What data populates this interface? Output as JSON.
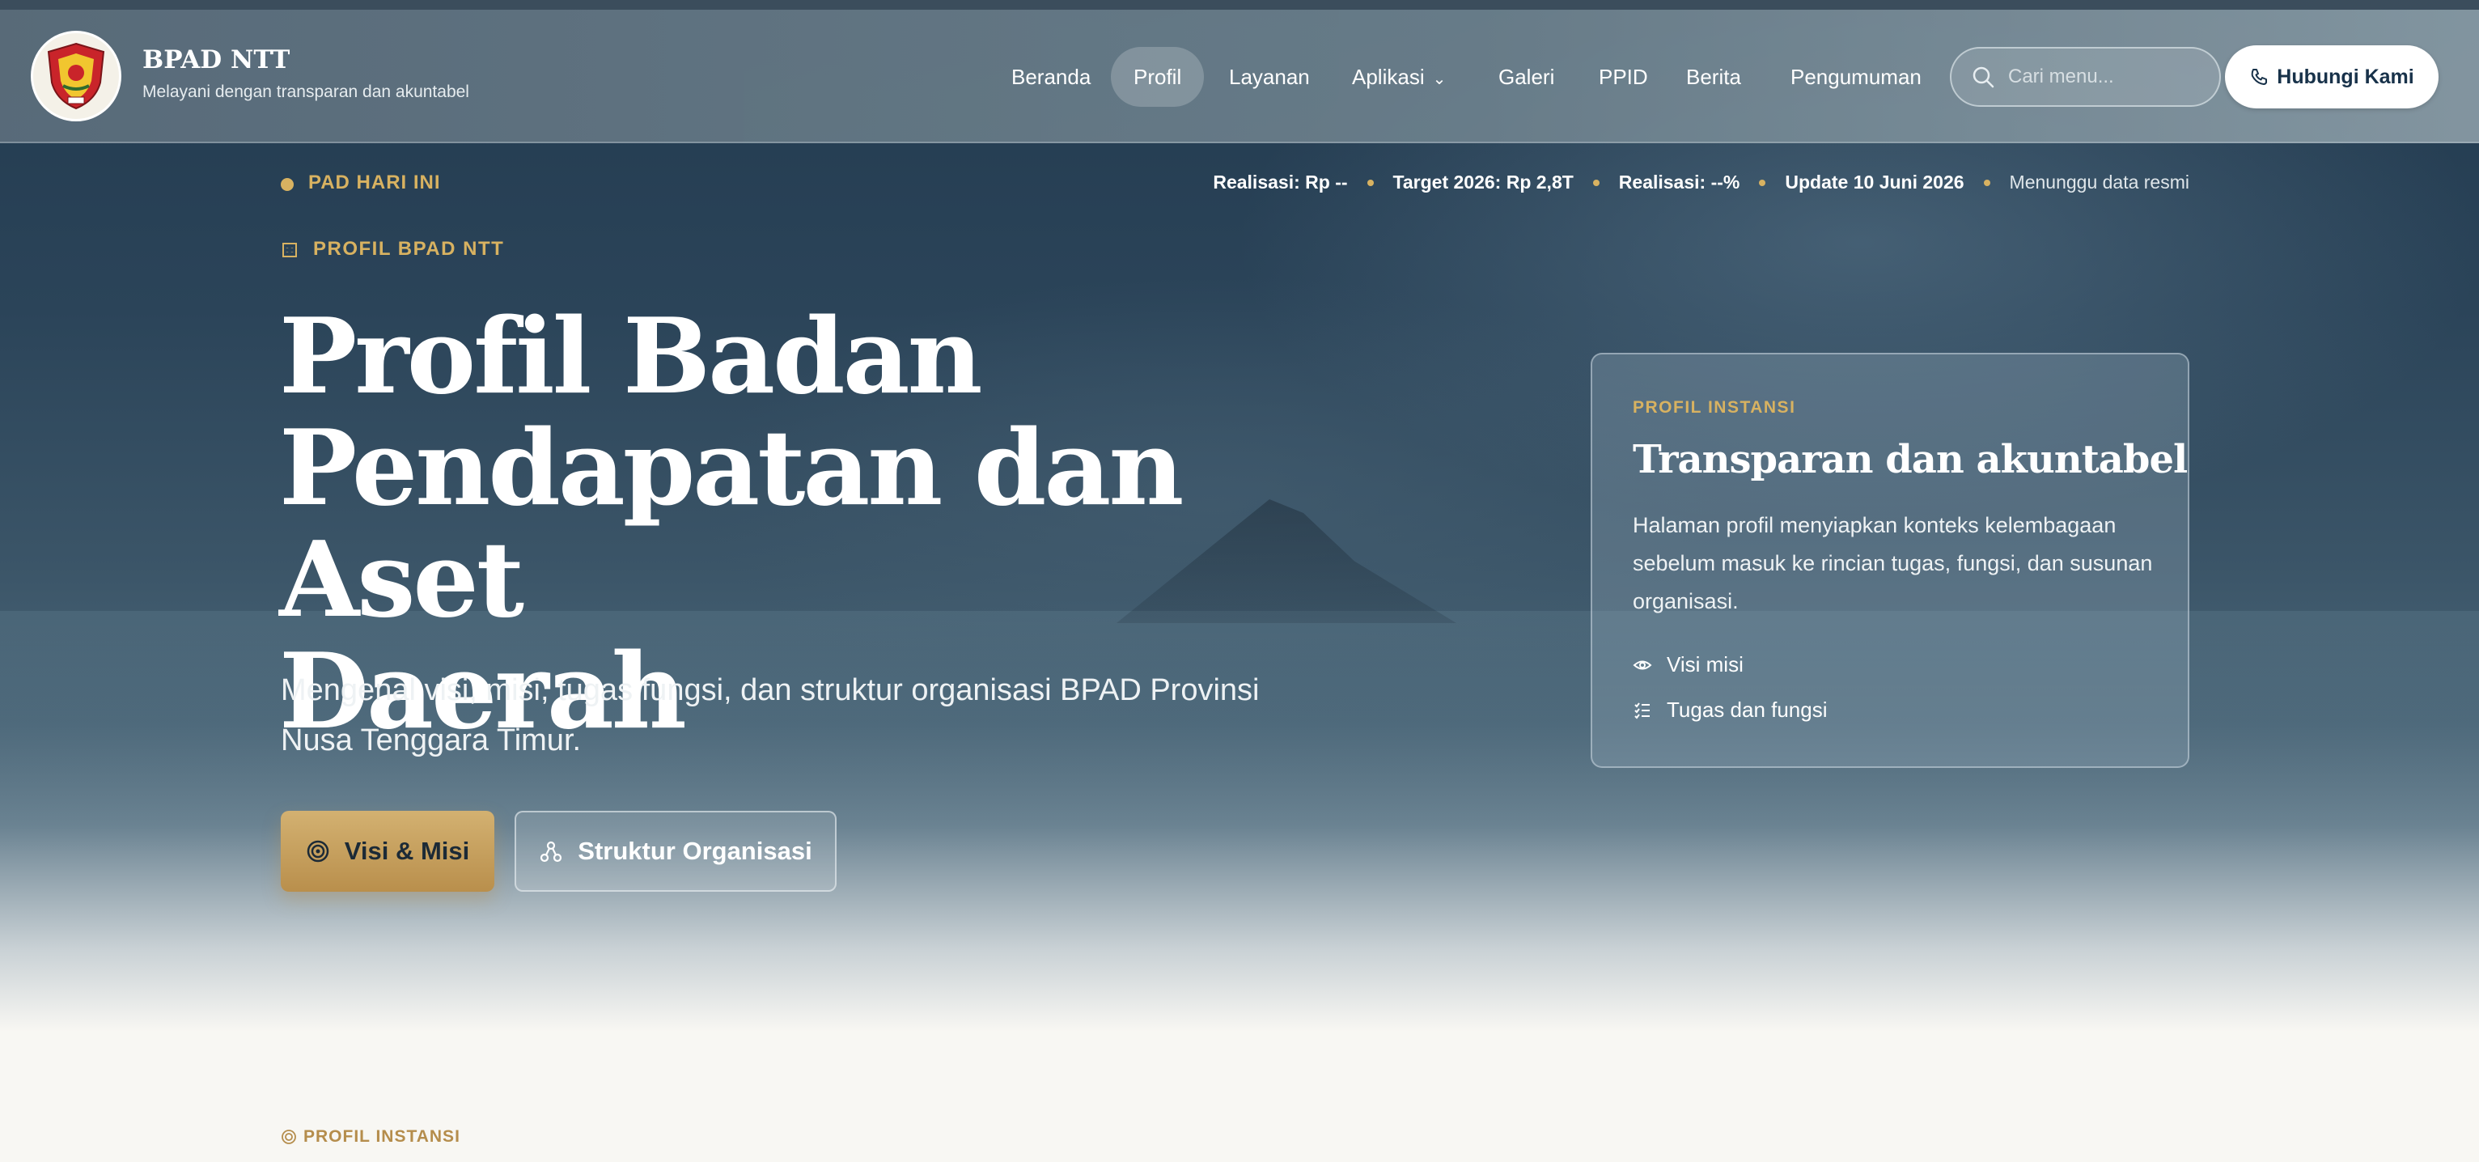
{
  "brand": {
    "title": "BPAD NTT",
    "subtitle": "Melayani dengan transparan dan akuntabel"
  },
  "nav": {
    "items": [
      {
        "label": "Beranda"
      },
      {
        "label": "Profil",
        "active": true
      },
      {
        "label": "Layanan"
      },
      {
        "label": "Aplikasi",
        "dropdown": true
      },
      {
        "label": "Galeri"
      },
      {
        "label": "PPID"
      },
      {
        "label": "Berita"
      },
      {
        "label": "Pengumuman"
      }
    ],
    "search_placeholder": "Cari menu...",
    "contact_label": "Hubungi Kami"
  },
  "ticker": {
    "label": "PAD HARI INI",
    "realisasi_rp_key": "Realisasi:",
    "realisasi_rp_value": "Rp --",
    "target_key": "Target 2026:",
    "target_value": "Rp 2,8T",
    "realisasi_pct_key": "Realisasi:",
    "realisasi_pct_value": "--%",
    "update": "Update 10 Juni 2026",
    "status": "Menunggu data resmi"
  },
  "hero": {
    "eyebrow": "PROFIL BPAD NTT",
    "title_line1": "Profil Badan",
    "title_line2": "Pendapatan dan Aset",
    "title_line3": "Daerah",
    "description": "Mengenal visi, misi, tugas fungsi, dan struktur organisasi BPAD Provinsi Nusa Tenggara Timur.",
    "primary_button": "Visi & Misi",
    "secondary_button": "Struktur Organisasi"
  },
  "card": {
    "eyebrow": "PROFIL INSTANSI",
    "title": "Transparan dan akuntabel",
    "description": "Halaman profil menyiapkan konteks kelembagaan sebelum masuk ke rincian tugas, fungsi, dan susunan organisasi.",
    "link1": "Visi misi",
    "link2": "Tugas dan fungsi"
  },
  "section": {
    "eyebrow": "PROFIL INSTANSI"
  },
  "colors": {
    "accent_gold": "#d8b261",
    "navy": "#18324a",
    "page_bg": "#f8f7f3"
  }
}
